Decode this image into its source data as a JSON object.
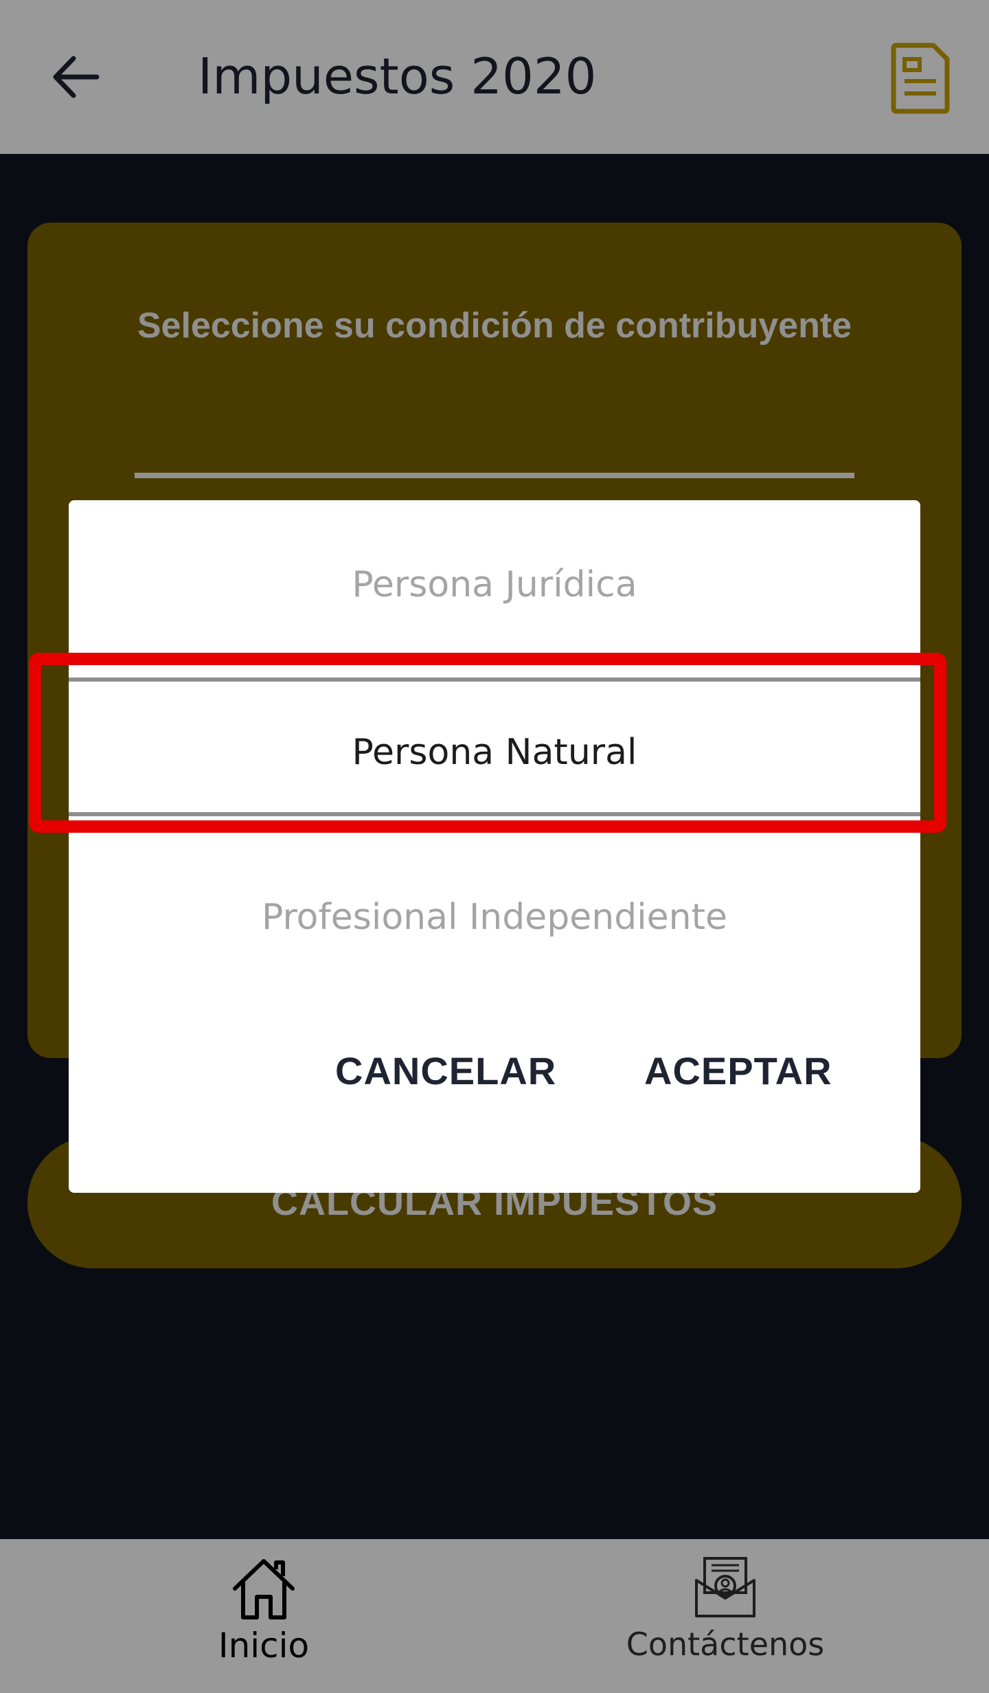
{
  "appbar": {
    "title": "Impuestos 2020",
    "back_icon": "arrow-left-icon",
    "doc_icon": "document-icon"
  },
  "card": {
    "title": "Seleccione su condición de contribuyente"
  },
  "calculate_button": {
    "label": "CALCULAR IMPUESTOS"
  },
  "dialog": {
    "options": [
      {
        "label": "Persona Jurídica"
      },
      {
        "label": "Persona Natural"
      },
      {
        "label": "Profesional Independiente"
      }
    ],
    "selected": "Persona Natural",
    "cancel_label": "CANCELAR",
    "accept_label": "ACEPTAR"
  },
  "bottom_nav": {
    "items": [
      {
        "label": "Inicio",
        "icon": "home-icon"
      },
      {
        "label": "Contáctenos",
        "icon": "contact-mail-icon"
      }
    ]
  },
  "colors": {
    "accent": "#7a6100",
    "background": "#111420",
    "highlight": "#e60000"
  }
}
